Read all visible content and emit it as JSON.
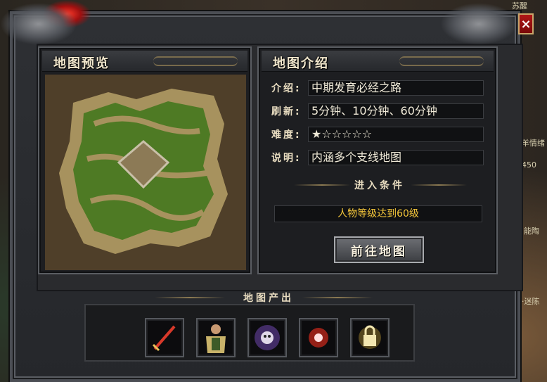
{
  "dialog": {
    "close_label": "×",
    "preview": {
      "title": "地图预览"
    },
    "intro": {
      "title": "地图介绍",
      "rows": [
        {
          "label": "介绍:",
          "value": "中期发育必经之路"
        },
        {
          "label": "刷新:",
          "value": "5分钟、10分钟、60分钟"
        },
        {
          "label": "难度:",
          "value": "★☆☆☆☆☆"
        },
        {
          "label": "说明:",
          "value": "内涵多个支线地图"
        }
      ],
      "entry_conditions_title": "进入条件",
      "requirement": "人物等级达到60级",
      "go_button": "前往地图"
    },
    "drops": {
      "title": "地图产出",
      "items": [
        {
          "icon": "sword-icon"
        },
        {
          "icon": "armor-icon"
        },
        {
          "icon": "skull-orb-icon"
        },
        {
          "icon": "fire-orb-icon"
        },
        {
          "icon": "lock-book-icon"
        }
      ]
    }
  },
  "background_text": [
    "苏醒",
    "羊情绪",
    "450",
    "能陶",
    "·迷陈"
  ],
  "colors": {
    "accent_gold": "#f3c53a",
    "close_red": "#b01616"
  }
}
